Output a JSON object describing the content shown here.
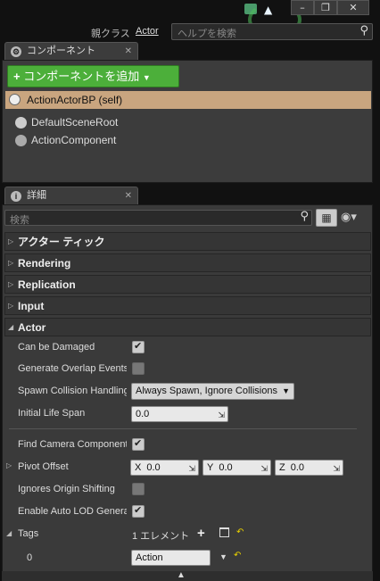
{
  "window": {
    "minimize_icon": "minimize-icon",
    "restore_icon": "restore-icon",
    "close_icon": "close-icon"
  },
  "header": {
    "parent_class_label": "親クラス",
    "parent_class_value": "Actor",
    "help_search_placeholder": "ヘルプを検索"
  },
  "components": {
    "tab_label": "コンポーネント",
    "add_button_label": "コンポーネントを追加",
    "self_item": "ActionActorBP (self)",
    "items": [
      "DefaultSceneRoot",
      "ActionComponent"
    ]
  },
  "details": {
    "tab_label": "詳細",
    "search_placeholder": "検索",
    "categories": [
      "アクター ティック",
      "Rendering",
      "Replication",
      "Input",
      "Actor"
    ],
    "actor": {
      "can_be_damaged": "Can be Damaged",
      "generate_overlap": "Generate Overlap Events",
      "spawn_collision": "Spawn Collision Handling",
      "spawn_collision_value": "Always Spawn, Ignore Collisions",
      "initial_life_span": "Initial Life Span",
      "initial_life_span_value": "0.0",
      "find_camera": "Find Camera Component",
      "pivot_offset": "Pivot Offset",
      "pivot": {
        "x_label": "X",
        "x": "0.0",
        "y_label": "Y",
        "y": "0.0",
        "z_label": "Z",
        "z": "0.0"
      },
      "ignores_origin": "Ignores Origin Shifting",
      "enable_auto_lod": "Enable Auto LOD Generation",
      "tags": "Tags",
      "tags_count": "1 エレメント",
      "tag_index": "0",
      "tag_value": "Action"
    }
  },
  "colors": {
    "accent_green": "#4caf3a",
    "selection_tan": "#c9a57f"
  }
}
